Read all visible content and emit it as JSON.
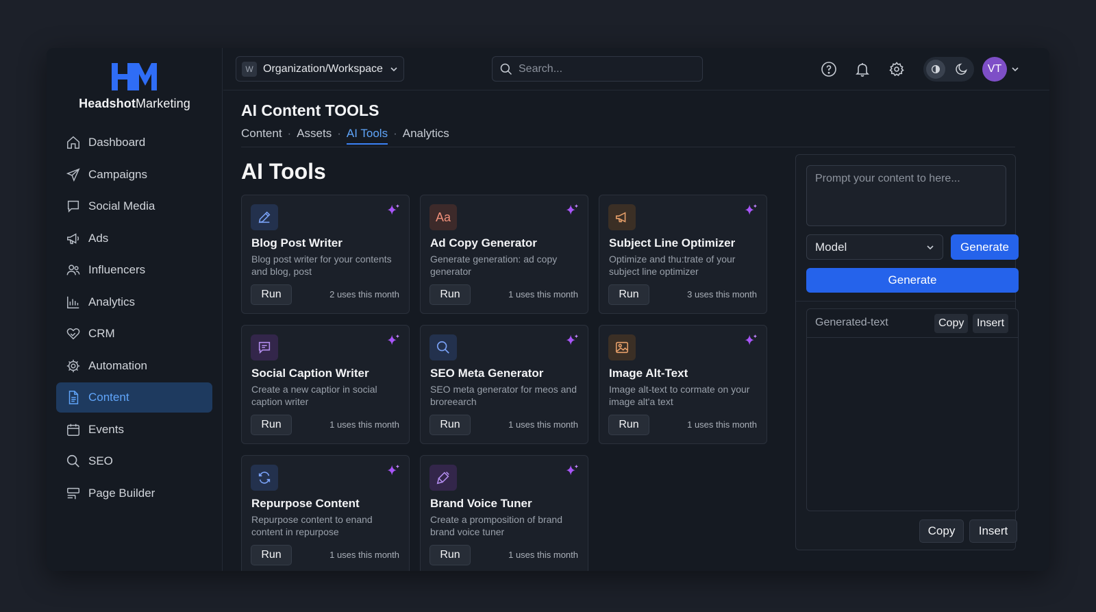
{
  "brand": {
    "logo_letters": "HM",
    "name_bold": "Headshot",
    "name_rest": "Marketing",
    "accent": "#3b82f6"
  },
  "sidebar": {
    "items": [
      {
        "label": "Dashboard",
        "icon": "home-icon"
      },
      {
        "label": "Campaigns",
        "icon": "send-icon"
      },
      {
        "label": "Social Media",
        "icon": "chat-icon"
      },
      {
        "label": "Ads",
        "icon": "megaphone-icon"
      },
      {
        "label": "Influencers",
        "icon": "users-icon"
      },
      {
        "label": "Analytics",
        "icon": "bar-chart-icon"
      },
      {
        "label": "CRM",
        "icon": "handshake-icon"
      },
      {
        "label": "Automation",
        "icon": "gear-icon"
      },
      {
        "label": "Content",
        "icon": "document-icon",
        "active": true
      },
      {
        "label": "Events",
        "icon": "calendar-icon"
      },
      {
        "label": "SEO",
        "icon": "search-icon"
      },
      {
        "label": "Page Builder",
        "icon": "layout-icon"
      }
    ]
  },
  "topbar": {
    "workspace_badge": "W",
    "workspace": "Organization/Workspace",
    "search_placeholder": "Search...",
    "avatar_initials": "VT"
  },
  "page": {
    "title": "AI Content TOOLS",
    "breadcrumbs": [
      "Content",
      "Assets",
      "AI Tools",
      "Analytics"
    ],
    "section_heading": "AI Tools"
  },
  "tools": [
    {
      "title": "Blog Post Writer",
      "desc": "Blog post writer for your contents and blog, post",
      "uses": "2 uses this month",
      "run": "Run",
      "icon": "pencil-icon",
      "icon_text": "",
      "icon_bg": "#23314d",
      "icon_color": "#7aa2f7"
    },
    {
      "title": "Ad Copy Generator",
      "desc": "Generate generation: ad copy generator",
      "uses": "1 uses this month",
      "run": "Run",
      "icon": "text-aa-icon",
      "icon_text": "Aa",
      "icon_bg": "#3d2a2a",
      "icon_color": "#f0907a"
    },
    {
      "title": "Subject Line Optimizer",
      "desc": "Optimize and thu:trate of your subject line optimizer",
      "uses": "3 uses this month",
      "run": "Run",
      "icon": "megaphone-icon",
      "icon_text": "",
      "icon_bg": "#3b2f25",
      "icon_color": "#e8a06a"
    },
    {
      "title": "Social Caption Writer",
      "desc": "Create a new captior in social caption writer",
      "uses": "1 uses this month",
      "run": "Run",
      "icon": "message-icon",
      "icon_text": "",
      "icon_bg": "#33264a",
      "icon_color": "#b48ef0"
    },
    {
      "title": "SEO Meta Generator",
      "desc": "SEO meta generator for meos and broreearch",
      "uses": "1 uses this month",
      "run": "Run",
      "icon": "search-icon",
      "icon_text": "",
      "icon_bg": "#23314d",
      "icon_color": "#7aa2f7"
    },
    {
      "title": "Image Alt-Text",
      "desc": "Image alt-text to cormate on your image alt'a text",
      "uses": "1 uses this month",
      "run": "Run",
      "icon": "image-icon",
      "icon_text": "",
      "icon_bg": "#3b2f25",
      "icon_color": "#e8a06a"
    },
    {
      "title": "Repurpose Content",
      "desc": "Repurpose content to enand content in repurpose",
      "uses": "1 uses this month",
      "run": "Run",
      "icon": "refresh-icon",
      "icon_text": "",
      "icon_bg": "#23314d",
      "icon_color": "#7aa2f7"
    },
    {
      "title": "Brand Voice Tuner",
      "desc": "Create a promposition of brand brand voice tuner",
      "uses": "1 uses this month",
      "run": "Run",
      "icon": "brush-icon",
      "icon_text": "",
      "icon_bg": "#33264a",
      "icon_color": "#b48ef0"
    }
  ],
  "panel": {
    "prompt_placeholder": "Prompt your content to here...",
    "model_label": "Model",
    "generate_small": "Generate",
    "generate_large": "Generate",
    "output_label": "Generated-text",
    "copy": "Copy",
    "insert": "Insert",
    "footer_copy": "Copy",
    "footer_insert": "Insert"
  },
  "colors": {
    "primary": "#2563eb",
    "active_nav_bg": "#1e3a5f",
    "sparkle": "#a855f7",
    "avatar": "#7e4fc7"
  }
}
